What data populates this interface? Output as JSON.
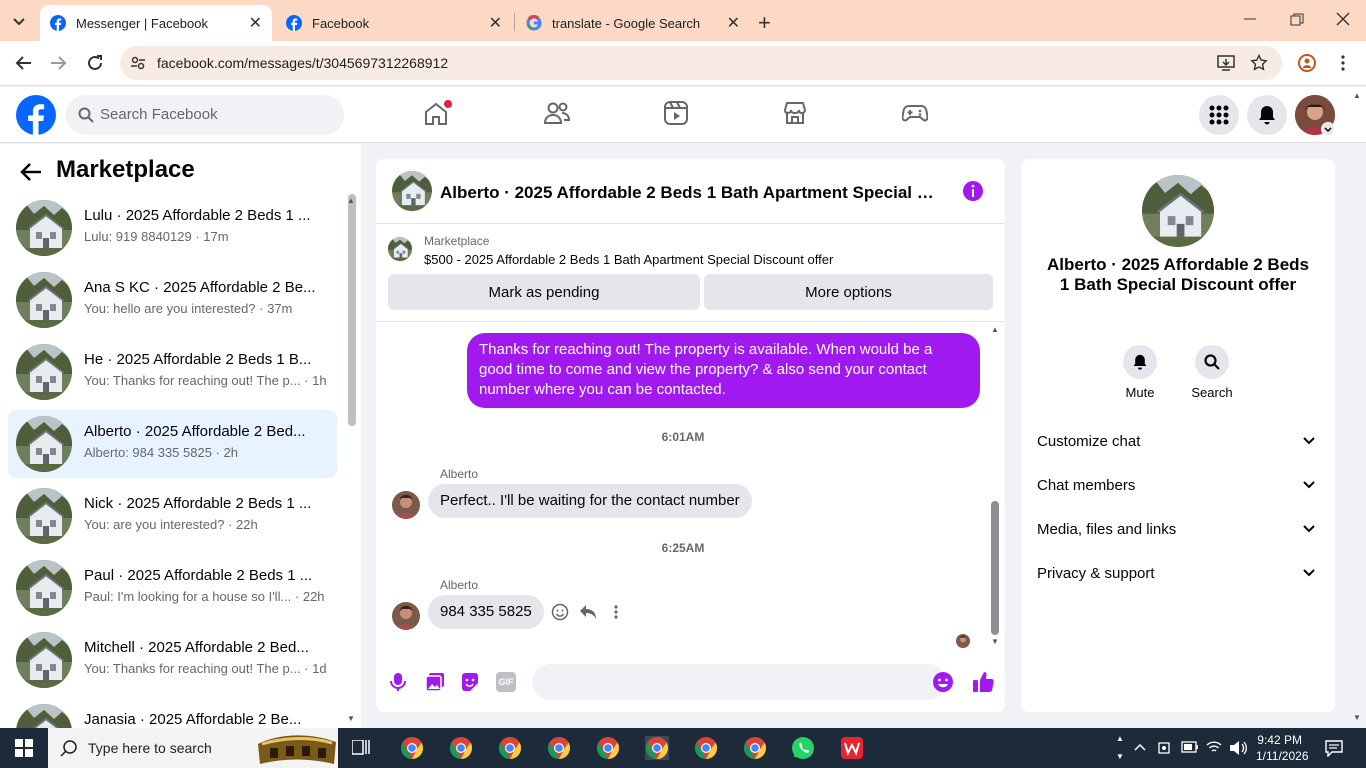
{
  "browser": {
    "tabs": [
      {
        "title": "Messenger | Facebook",
        "active": true
      },
      {
        "title": "Facebook",
        "active": false
      },
      {
        "title": "translate - Google Search",
        "active": false
      }
    ],
    "url": "facebook.com/messages/t/3045697312268912"
  },
  "fb": {
    "search_placeholder": "Search Facebook"
  },
  "left": {
    "title": "Marketplace",
    "conversations": [
      {
        "name": "Lulu · 2025 Affordable 2 Beds 1 ...",
        "preview": "Lulu: 919 8840129 · 17m",
        "selected": false
      },
      {
        "name": "Ana S KC · 2025 Affordable 2 Be...",
        "preview": "You: hello are you interested? · 37m",
        "selected": false
      },
      {
        "name": "He · 2025 Affordable 2 Beds 1 B...",
        "preview": "You: Thanks for reaching out! The p... · 1h",
        "selected": false
      },
      {
        "name": "Alberto · 2025 Affordable 2 Bed...",
        "preview": "Alberto: 984 335 5825 · 2h",
        "selected": true
      },
      {
        "name": "Nick · 2025 Affordable 2 Beds 1 ...",
        "preview": "You: are you interested? · 22h",
        "selected": false
      },
      {
        "name": "Paul · 2025 Affordable 2 Beds 1 ...",
        "preview": "Paul: I'm looking for a house so I'll... · 22h",
        "selected": false
      },
      {
        "name": "Mitchell · 2025 Affordable 2 Bed...",
        "preview": "You: Thanks for reaching out! The p... · 1d",
        "selected": false
      },
      {
        "name": "Janasia · 2025 Affordable 2 Be...",
        "preview": "",
        "selected": false
      }
    ]
  },
  "chat": {
    "title": "Alberto · 2025 Affordable 2 Beds 1 Bath Apartment Special Disc...",
    "marketplace_label": "Marketplace",
    "listing": "$500 - 2025 Affordable 2 Beds 1 Bath Apartment Special Discount offer",
    "mark_pending": "Mark as pending",
    "more_options": "More options",
    "outgoing": "Thanks for reaching out! The property is available. When would be a good time to come and view the property? & also send your contact number where you can be contacted.",
    "time1": "6:01AM",
    "sender1": "Alberto",
    "msg1": "Perfect.. I'll be waiting for the contact number",
    "time2": "6:25AM",
    "sender2": "Alberto",
    "msg2": "984 335 5825"
  },
  "right": {
    "name": "Alberto · 2025 Affordable 2 Beds 1 Bath Special Discount offer",
    "mute": "Mute",
    "search": "Search",
    "sections": [
      "Customize chat",
      "Chat members",
      "Media, files and links",
      "Privacy & support"
    ]
  },
  "taskbar": {
    "search_placeholder": "Type here to search",
    "time": "9:42 PM",
    "date": "1/11/2026"
  },
  "colors": {
    "accent": "#a01af0",
    "fb_blue": "#0866ff",
    "tab_bar": "#fbd9c4",
    "taskbar": "#1c2a3a"
  }
}
